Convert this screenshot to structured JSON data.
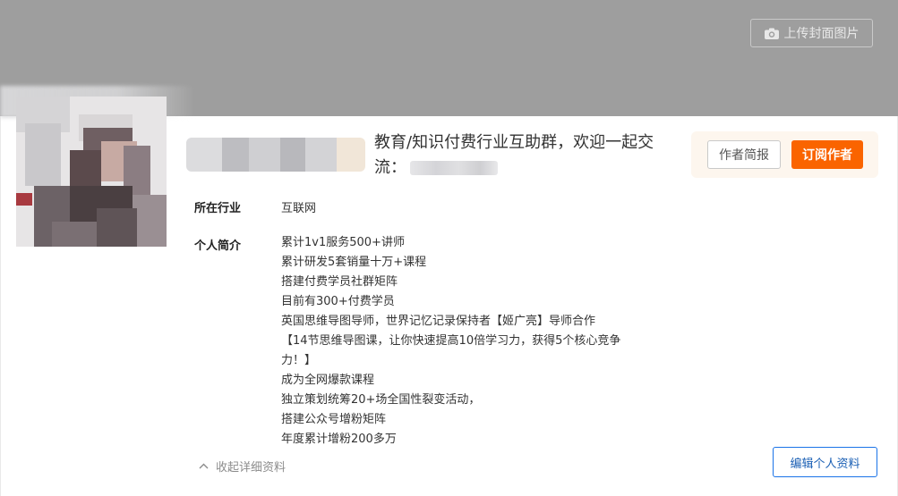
{
  "cover": {
    "upload_label": "上传封面图片",
    "upload_icon": "camera-icon",
    "background_color": "#9e9e9e"
  },
  "profile": {
    "headline_line1": "教育/知识付费行业互助群，欢迎一起交",
    "headline_line2": "流："
  },
  "actions": {
    "brief_label": "作者简报",
    "subscribe_label": "订阅作者",
    "subscribe_color": "#fa6400",
    "edit_label": "编辑个人资料",
    "collapse_label": "收起详细资料",
    "collapse_icon": "chevron-up-icon"
  },
  "fields": {
    "industry_label": "所在行业",
    "industry_value": "互联网",
    "intro_label": "个人简介",
    "intro_lines": [
      "累计1v1服务500+讲师",
      "累计研发5套销量十万+课程",
      "搭建付费学员社群矩阵",
      "目前有300+付费学员",
      "英国思维导图导师，世界记忆记录保持者【姬广亮】导师合作",
      "【14节思维导图课，让你快速提高10倍学习力，获得5个核心竞争",
      "力！】",
      "成为全网爆款课程",
      "独立策划统筹20+场全国性裂变活动，",
      "搭建公众号增粉矩阵",
      "年度累计增粉200多万"
    ]
  }
}
